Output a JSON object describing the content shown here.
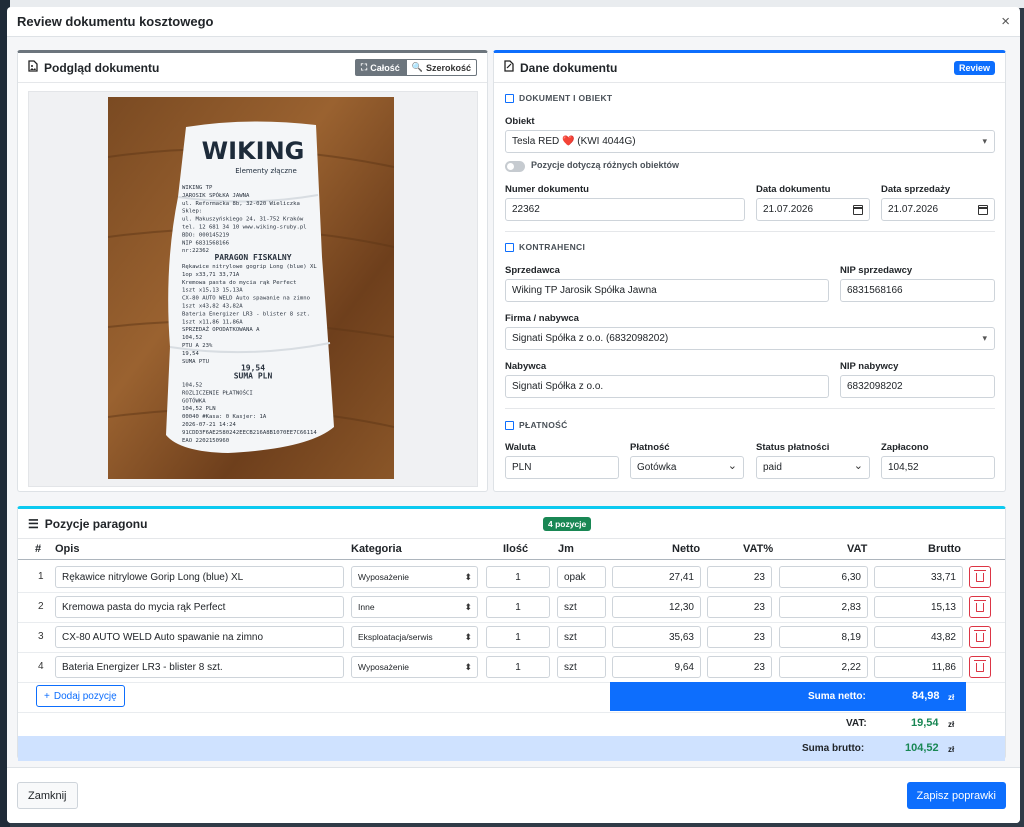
{
  "modal": {
    "title": "Review dokumentu kosztowego",
    "close": "×"
  },
  "preview": {
    "title": "Podgląd dokumentu",
    "btn_full": "Całość",
    "btn_width": "Szerokość",
    "receipt": {
      "brand": "WIKING",
      "brand_sub": "Elementy złączne",
      "lines": [
        "WIKING TP",
        "JAROSIK SPÓŁKA JAWNA",
        "ul. Reformacka 8b, 32-020 Wieliczka",
        "Sklep:",
        "ul. Makuszyńskiego 24, 31-752 Kraków",
        "tel. 12 681 34 10 www.wiking-sruby.pl",
        "BDO: 000145219",
        "NIP 6831568166",
        "nr:22362",
        "PARAGON FISKALNY",
        "Rękawice nitrylowe gogrip Long (blue) XL",
        "1op x33,71 33,71A",
        "Kremowa pasta do mycia rąk Perfect",
        "1szt x15,13 15,13A",
        "CX-80 AUTO WELD Auto spawanie na zimno",
        "1szt x43,82 43,82A",
        "Bateria Energizer LR3 - blister 8 szt.",
        "1szt x11,86 11,86A",
        "SPRZEDAŻ OPODATKOWANA A",
        "104,52",
        "PTU A 23%",
        "19,54",
        "SUMA PTU",
        "19,54",
        "SUMA PLN",
        "104,52",
        "ROZLICZENIE PŁATNOŚCI",
        "GOTÓWKA",
        "104,52 PLN",
        "00040 #Kasa: 0 Kasjer: 1A",
        "2026-07-21 14:24",
        "91CDD3F6AE2580242EECB216A8B1070EE7C66114",
        "EAO 2202150960"
      ]
    }
  },
  "data": {
    "title": "Dane dokumentu",
    "badge": "Review",
    "sec_doc": "DOKUMENT I OBIEKT",
    "obiekt_label": "Obiekt",
    "obiekt_value": "Tesla RED ❤️ (KWI 4044G)",
    "toggle_label": "Pozycje dotyczą różnych obiektów",
    "numer_label": "Numer dokumentu",
    "numer_value": "22362",
    "data_dok_label": "Data dokumentu",
    "data_dok_value": "21.07.2026",
    "data_sprz_label": "Data sprzedaży",
    "data_sprz_value": "21.07.2026",
    "sec_kontr": "KONTRAHENCI",
    "sprzedawca_label": "Sprzedawca",
    "sprzedawca_value": "Wiking TP Jarosik Spółka Jawna",
    "nip_sprz_label": "NIP sprzedawcy",
    "nip_sprz_value": "6831568166",
    "firma_label": "Firma / nabywca",
    "firma_value": "Signati Spółka z o.o. (6832098202)",
    "nabywca_label": "Nabywca",
    "nabywca_value": "Signati Spółka z o.o.",
    "nip_nab_label": "NIP nabywcy",
    "nip_nab_value": "6832098202",
    "sec_plat": "PŁATNOŚĆ",
    "waluta_label": "Waluta",
    "waluta_value": "PLN",
    "platnosc_label": "Płatność",
    "platnosc_value": "Gotówka",
    "status_label": "Status płatności",
    "status_value": "paid",
    "zaplacono_label": "Zapłacono",
    "zaplacono_value": "104,52"
  },
  "items": {
    "title": "Pozycje paragonu",
    "count_badge": "4 pozycje",
    "headers": {
      "num": "#",
      "opis": "Opis",
      "kategoria": "Kategoria",
      "ilosc": "Ilość",
      "jm": "Jm",
      "netto": "Netto",
      "vatp": "VAT%",
      "vat": "VAT",
      "brutto": "Brutto"
    },
    "rows": [
      {
        "n": "1",
        "opis": "Rękawice nitrylowe Gorip Long (blue) XL",
        "kat": "Wyposażenie",
        "ilosc": "1",
        "jm": "opak",
        "netto": "27,41",
        "vatp": "23",
        "vat": "6,30",
        "brutto": "33,71"
      },
      {
        "n": "2",
        "opis": "Kremowa pasta do mycia rąk Perfect",
        "kat": "Inne",
        "ilosc": "1",
        "jm": "szt",
        "netto": "12,30",
        "vatp": "23",
        "vat": "2,83",
        "brutto": "15,13"
      },
      {
        "n": "3",
        "opis": "CX-80 AUTO WELD Auto spawanie na zimno",
        "kat": "Eksploatacja/serwis",
        "ilosc": "1",
        "jm": "szt",
        "netto": "35,63",
        "vatp": "23",
        "vat": "8,19",
        "brutto": "43,82"
      },
      {
        "n": "4",
        "opis": "Bateria Energizer LR3 - blister 8 szt.",
        "kat": "Wyposażenie",
        "ilosc": "1",
        "jm": "szt",
        "netto": "9,64",
        "vatp": "23",
        "vat": "2,22",
        "brutto": "11,86"
      }
    ],
    "add_label": "Dodaj pozycję",
    "sum_netto_label": "Suma netto:",
    "sum_netto_value": "84,98",
    "vat_label": "VAT:",
    "vat_value": "19,54",
    "sum_brutto_label": "Suma brutto:",
    "sum_brutto_value": "104,52",
    "currency": "zł"
  },
  "footer": {
    "close": "Zamknij",
    "save": "Zapisz poprawki"
  },
  "colors": {
    "primary": "#0d6efd",
    "success": "#198754",
    "danger": "#dc3545",
    "info": "#0dcaf0"
  }
}
